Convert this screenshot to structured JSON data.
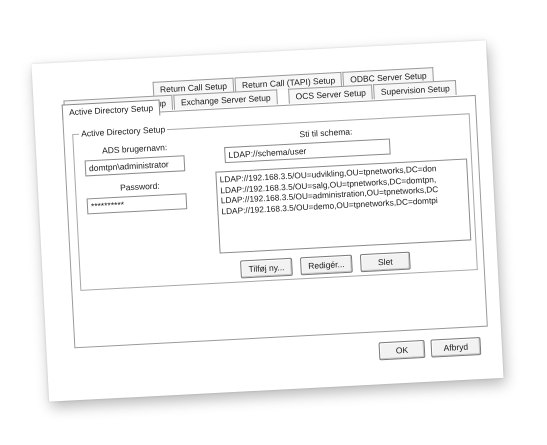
{
  "tabs_top": [
    {
      "label": "Return Call Setup"
    },
    {
      "label": "Return Call (TAPI) Setup"
    },
    {
      "label": "ODBC Server Setup"
    }
  ],
  "tabs_bottom": [
    {
      "label": "Supervision (TAPI) Setup"
    },
    {
      "label": "Exchange Server Setup"
    },
    {
      "label": "OCS Server Setup"
    },
    {
      "label": "Supervision Setup"
    }
  ],
  "active_tab": {
    "label": "Active Directory Setup"
  },
  "ad_group": {
    "legend": "Active Directory Setup",
    "username_label": "ADS brugernavn:",
    "username_value": "domtpn\\administrator",
    "password_label": "Password:",
    "password_value": "**********",
    "schema_label": "Sti til schema:",
    "schema_value": "LDAP://schema/user",
    "ldap_paths": [
      "LDAP://192.168.3.5/OU=udvikling,OU=tpnetworks,DC=don",
      "LDAP://192.168.3.5/OU=salg,OU=tpnetworks,DC=domtpn,",
      "LDAP://192.168.3.5/OU=administration,OU=tpnetworks,DC",
      "LDAP://192.168.3.5/OU=demo,OU=tpnetworks,DC=domtpi"
    ],
    "add_button": "Tilføj ny...",
    "edit_button": "Redigér...",
    "delete_button": "Slet"
  },
  "footer": {
    "ok_button": "OK",
    "cancel_button": "Afbryd"
  }
}
